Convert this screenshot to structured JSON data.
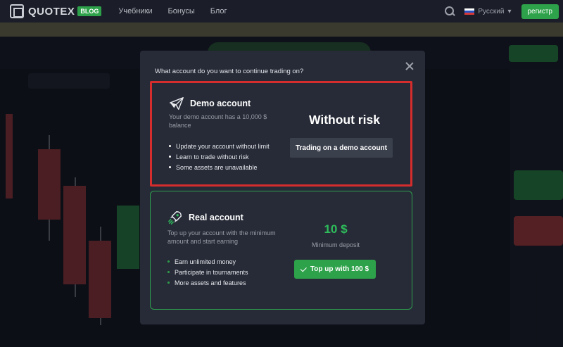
{
  "brand": {
    "logo": "QUOTEX",
    "badge": "BLOG"
  },
  "nav": {
    "links": [
      "Учебники",
      "Бонусы",
      "Блог"
    ],
    "language": "Русский",
    "register": "регистр"
  },
  "modal": {
    "question": "What account do you want to continue trading on?",
    "demo": {
      "title": "Demo account",
      "description": "Your demo account has a 10,000 $ balance",
      "features": [
        "Update your account without limit",
        "Learn to trade without risk",
        "Some assets are unavailable"
      ],
      "headline": "Without risk",
      "button": "Trading on a demo account",
      "icon": "paper-plane-icon"
    },
    "real": {
      "title": "Real account",
      "description": "Top up your account with the minimum amount and start earning",
      "features": [
        "Earn unlimited money",
        "Participate in tournaments",
        "More assets and features"
      ],
      "min_amount": "10 $",
      "min_label": "Minimum deposit",
      "button": "Top up with 100 $",
      "icon": "rocket-icon"
    }
  },
  "colors": {
    "accent_green": "#2ea24a",
    "highlight_red": "#d52d2d",
    "modal_bg": "#272b37"
  }
}
